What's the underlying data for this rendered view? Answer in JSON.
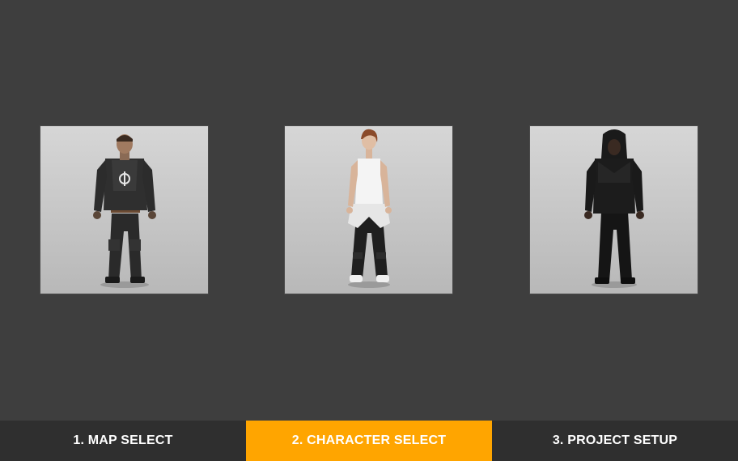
{
  "characters": [
    {
      "icon": "character-soldier-icon"
    },
    {
      "icon": "character-tank-top-woman-icon"
    },
    {
      "icon": "character-hooded-icon"
    }
  ],
  "tabs": {
    "items": [
      {
        "label": "1. MAP SELECT"
      },
      {
        "label": "2. CHARACTER SELECT"
      },
      {
        "label": "3. PROJECT SETUP"
      }
    ],
    "active_index": 1,
    "active_color": "#ffa500"
  },
  "colors": {
    "background": "#3e3e3e",
    "tabbar": "#2f2f2f",
    "text": "#ffffff"
  }
}
